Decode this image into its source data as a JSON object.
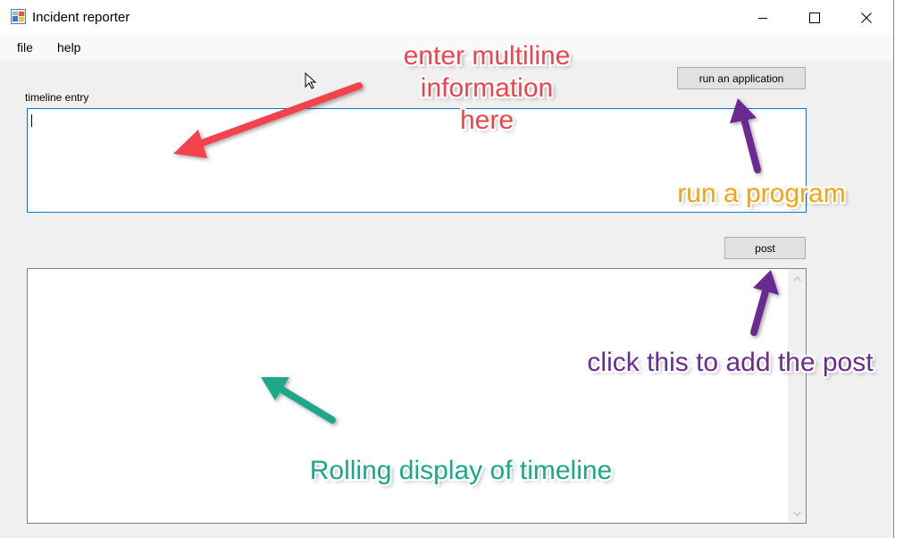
{
  "window": {
    "title": "Incident reporter",
    "controls": {
      "minimize": "minimize-icon",
      "maximize": "maximize-icon",
      "close": "close-icon"
    }
  },
  "menu": {
    "items": [
      {
        "label": "file"
      },
      {
        "label": "help"
      }
    ]
  },
  "form": {
    "timeline_label": "timeline entry",
    "timeline_value": "",
    "run_button_label": "run an application",
    "post_button_label": "post",
    "display_value": ""
  },
  "annotations": {
    "enter": [
      "enter multiline",
      "information",
      "here"
    ],
    "run": "run a program",
    "click": "click this to add the post",
    "rolling": "Rolling display of timeline"
  },
  "colors": {
    "anno_red": "#f2434b",
    "anno_orange": "#f5a310",
    "anno_purple": "#6a2c91",
    "anno_green": "#1ba889",
    "focus_blue": "#0078d7"
  }
}
